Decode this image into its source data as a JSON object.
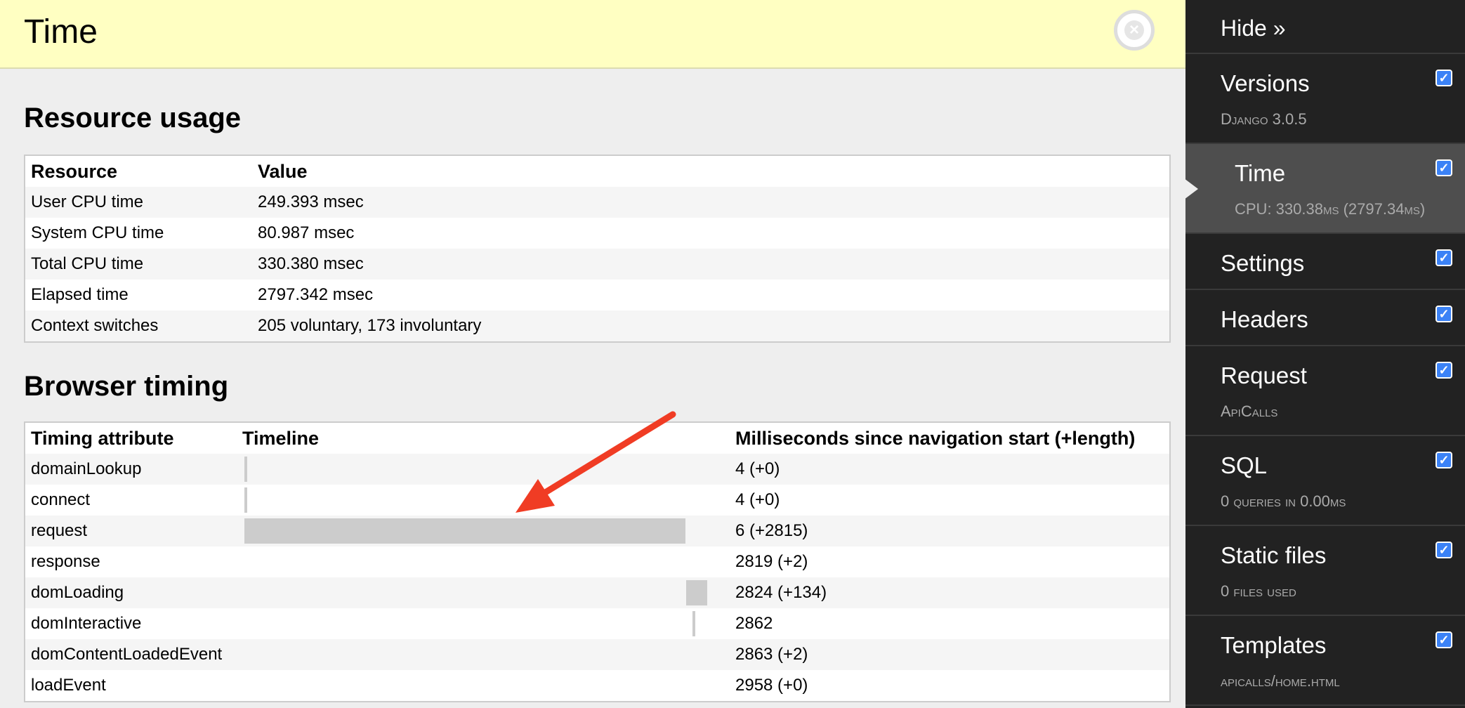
{
  "panel": {
    "title": "Time",
    "close_icon": "close-icon"
  },
  "resource_usage": {
    "heading": "Resource usage",
    "columns": [
      "Resource",
      "Value"
    ],
    "rows": [
      {
        "resource": "User CPU time",
        "value": "249.393 msec"
      },
      {
        "resource": "System CPU time",
        "value": "80.987 msec"
      },
      {
        "resource": "Total CPU time",
        "value": "330.380 msec"
      },
      {
        "resource": "Elapsed time",
        "value": "2797.342 msec"
      },
      {
        "resource": "Context switches",
        "value": "205 voluntary, 173 involuntary"
      }
    ]
  },
  "browser_timing": {
    "heading": "Browser timing",
    "columns": [
      "Timing attribute",
      "Timeline",
      "Milliseconds since navigation start (+length)"
    ],
    "total_ms": 2958,
    "rows": [
      {
        "attribute": "domainLookup",
        "start": 4,
        "length": 0,
        "text": "4 (+0)"
      },
      {
        "attribute": "connect",
        "start": 4,
        "length": 0,
        "text": "4 (+0)"
      },
      {
        "attribute": "request",
        "start": 6,
        "length": 2815,
        "text": "6 (+2815)"
      },
      {
        "attribute": "response",
        "start": 2819,
        "length": 2,
        "text": "2819 (+2)"
      },
      {
        "attribute": "domLoading",
        "start": 2824,
        "length": 134,
        "text": "2824 (+134)"
      },
      {
        "attribute": "domInteractive",
        "start": 2862,
        "length": 0,
        "text": "2862"
      },
      {
        "attribute": "domContentLoadedEvent",
        "start": 2863,
        "length": 2,
        "text": "2863 (+2)"
      },
      {
        "attribute": "loadEvent",
        "start": 2958,
        "length": 0,
        "text": "2958 (+0)"
      }
    ]
  },
  "annotation": {
    "arrow_color": "#f03c24"
  },
  "sidebar": {
    "hide_label": "Hide »",
    "items": [
      {
        "title": "Versions",
        "subtitle": "Django 3.0.5",
        "checked": true,
        "active": false
      },
      {
        "title": "Time",
        "subtitle": "CPU: 330.38ms (2797.34ms)",
        "checked": true,
        "active": true
      },
      {
        "title": "Settings",
        "subtitle": "",
        "checked": true,
        "active": false
      },
      {
        "title": "Headers",
        "subtitle": "",
        "checked": true,
        "active": false
      },
      {
        "title": "Request",
        "subtitle": "ApiCalls",
        "checked": true,
        "active": false
      },
      {
        "title": "SQL",
        "subtitle": "0 queries in 0.00ms",
        "checked": true,
        "active": false
      },
      {
        "title": "Static files",
        "subtitle": "0 files used",
        "checked": true,
        "active": false
      },
      {
        "title": "Templates",
        "subtitle": "apicalls/home.html",
        "checked": true,
        "active": false
      }
    ],
    "colors": {
      "background": "#222222",
      "active": "#4e4e4e",
      "checkbox": "#3b82f6"
    }
  }
}
